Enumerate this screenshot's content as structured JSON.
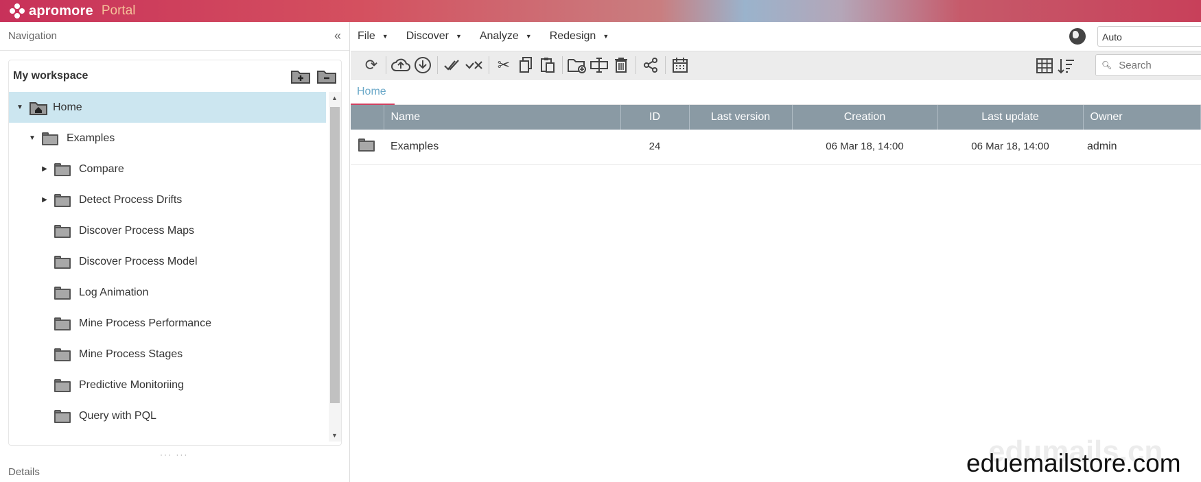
{
  "banner": {
    "brand": "apromore",
    "portal": "Portal"
  },
  "nav": {
    "title": "Navigation",
    "collapse_icon": "double-chevron-left-icon",
    "workspace_title": "My workspace",
    "tree": [
      {
        "label": "Home",
        "icon": "home-folder-icon",
        "caret": "down"
      },
      {
        "label": "Examples",
        "icon": "folder-icon",
        "caret": "down"
      },
      {
        "label": "Compare",
        "icon": "folder-icon",
        "caret": "right"
      },
      {
        "label": "Detect Process Drifts",
        "icon": "folder-icon",
        "caret": "right"
      },
      {
        "label": "Discover Process Maps",
        "icon": "folder-icon",
        "caret": ""
      },
      {
        "label": "Discover Process Model",
        "icon": "folder-icon",
        "caret": ""
      },
      {
        "label": "Log Animation",
        "icon": "folder-icon",
        "caret": ""
      },
      {
        "label": "Mine Process Performance",
        "icon": "folder-icon",
        "caret": ""
      },
      {
        "label": "Mine Process Stages",
        "icon": "folder-icon",
        "caret": ""
      },
      {
        "label": "Predictive Monitoriing",
        "icon": "folder-icon",
        "caret": ""
      },
      {
        "label": "Query with PQL",
        "icon": "folder-icon",
        "caret": ""
      }
    ],
    "details": "Details"
  },
  "menu": {
    "items": [
      {
        "label": "File"
      },
      {
        "label": "Discover"
      },
      {
        "label": "Analyze"
      },
      {
        "label": "Redesign"
      }
    ],
    "language_value": "Auto"
  },
  "toolbar": {
    "search_placeholder": "Search"
  },
  "breadcrumb": {
    "home": "Home"
  },
  "table": {
    "headers": {
      "name": "Name",
      "id": "ID",
      "last_version": "Last version",
      "creation": "Creation",
      "last_update": "Last update",
      "owner": "Owner"
    },
    "rows": [
      {
        "name": "Examples",
        "id": "24",
        "last_version": "",
        "creation": "06 Mar 18, 14:00",
        "last_update": "06 Mar 18, 14:00",
        "owner": "admin"
      }
    ]
  },
  "watermark": {
    "faint": "edumails.cn",
    "main": "eduemailstore.com"
  }
}
